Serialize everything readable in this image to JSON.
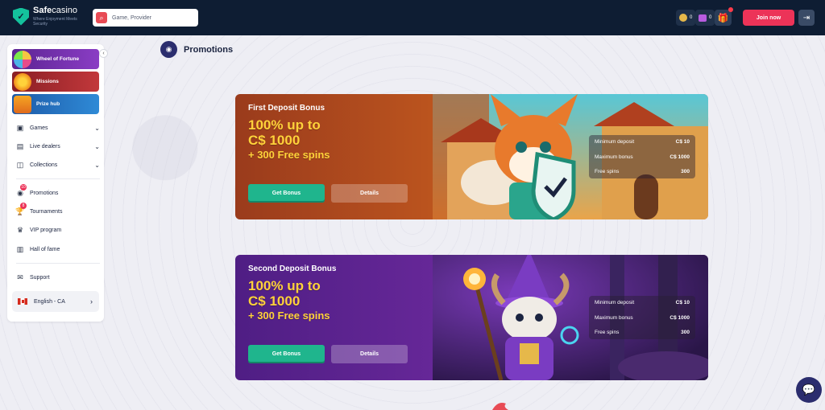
{
  "header": {
    "logo_name_bold": "Safe",
    "logo_name_rest": "casino",
    "logo_tagline": "Where Enjoyment Meets Security",
    "search_placeholder": "Game, Provider",
    "coins_value": "0",
    "gems_value": "0",
    "join_label": "Join now"
  },
  "sidebar": {
    "tiles": [
      {
        "label": "Wheel of Fortune",
        "color": "#7a2fb8",
        "icon": "wheel-icon"
      },
      {
        "label": "Missions",
        "color": "#a82a2e",
        "icon": "missions-icon"
      },
      {
        "label": "Prize hub",
        "color": "#2a73c6",
        "icon": "prize-icon"
      }
    ],
    "nav": [
      {
        "label": "Games",
        "icon": "games-icon"
      },
      {
        "label": "Live dealers",
        "icon": "live-dealers-icon"
      },
      {
        "label": "Collections",
        "icon": "collections-icon"
      }
    ],
    "links": [
      {
        "label": "Promotions",
        "icon": "promotions-icon",
        "badge": "10"
      },
      {
        "label": "Tournaments",
        "icon": "tournaments-icon",
        "badge": "8"
      },
      {
        "label": "VIP program",
        "icon": "crown-icon"
      },
      {
        "label": "Hall of fame",
        "icon": "hall-of-fame-icon"
      }
    ],
    "support_label": "Support",
    "language_label": "English - CA"
  },
  "page": {
    "title": "Promotions"
  },
  "banners": [
    {
      "name": "First Deposit Bonus",
      "offer_line1": "100% up to",
      "offer_line2": "C$ 1000",
      "offer_line3": "+ 300 Free spins",
      "get_label": "Get Bonus",
      "details_label": "Details",
      "terms": [
        {
          "label": "Minimum deposit",
          "value": "C$ 10"
        },
        {
          "label": "Maximum bonus",
          "value": "C$ 1000"
        },
        {
          "label": "Free spins",
          "value": "300"
        }
      ]
    },
    {
      "name": "Second Deposit Bonus",
      "offer_line1": "100% up to",
      "offer_line2": "C$ 1000",
      "offer_line3": "+ 300 Free spins",
      "get_label": "Get Bonus",
      "details_label": "Details",
      "terms": [
        {
          "label": "Minimum deposit",
          "value": "C$ 10"
        },
        {
          "label": "Maximum bonus",
          "value": "C$ 1000"
        },
        {
          "label": "Free spins",
          "value": "300"
        }
      ]
    }
  ]
}
